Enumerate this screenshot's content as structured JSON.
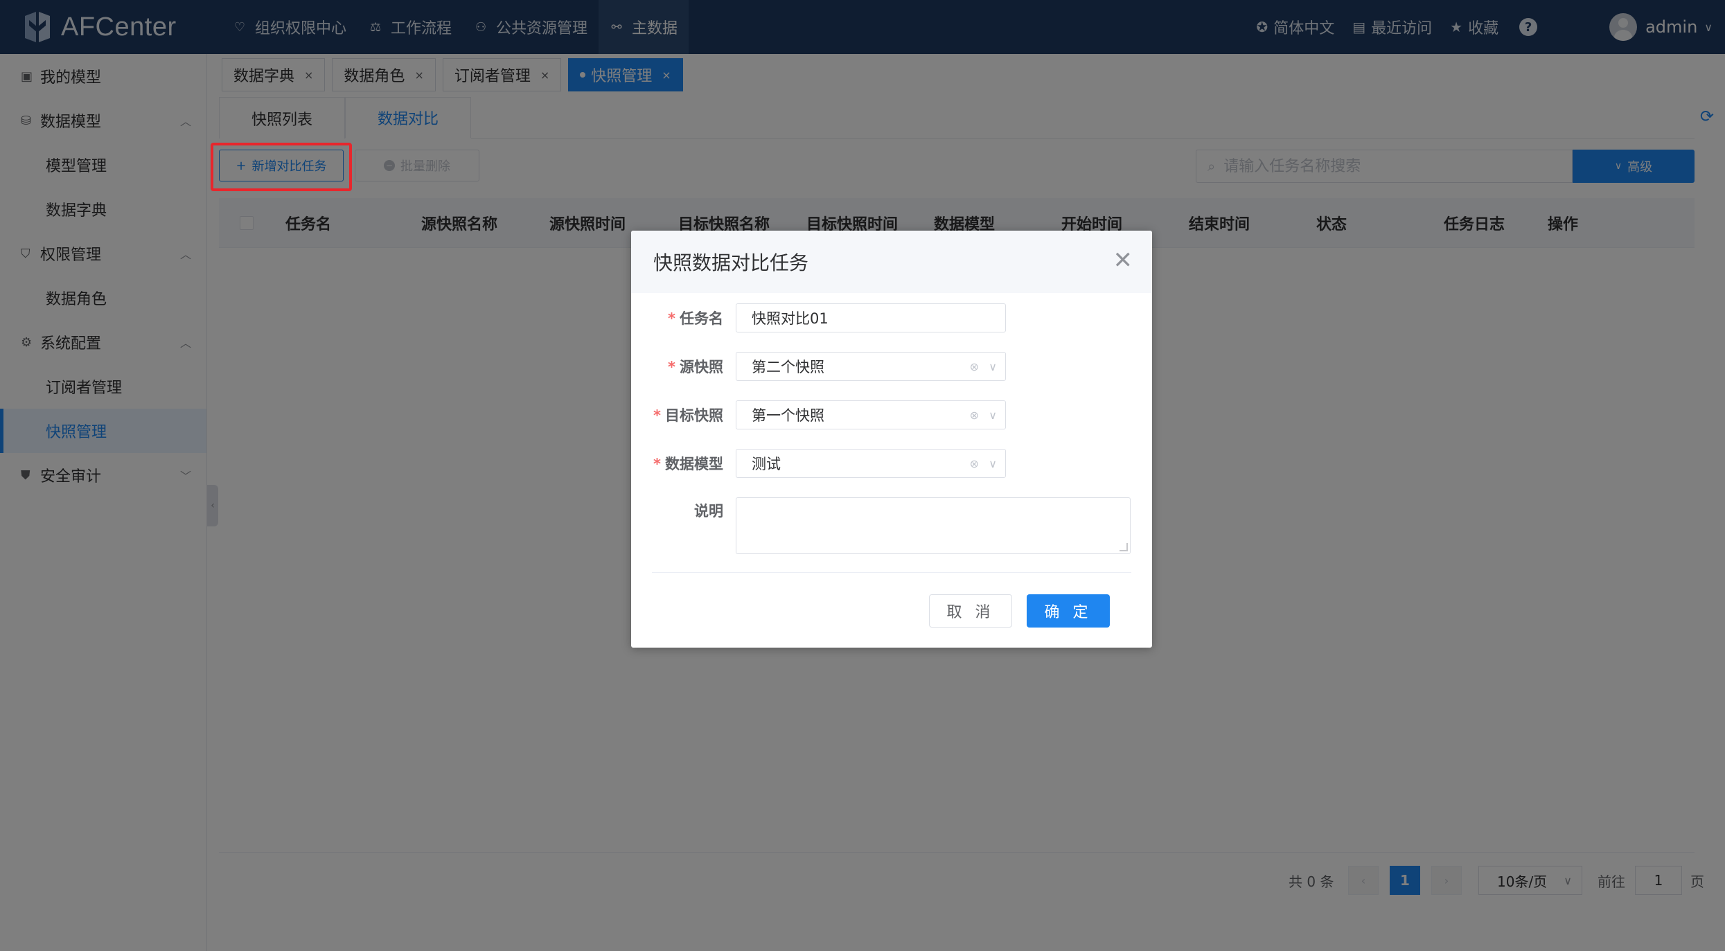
{
  "app": {
    "logo_text": "AFCenter",
    "nav": [
      {
        "label": "组织权限中心",
        "icon": "shield-icon"
      },
      {
        "label": "工作流程",
        "icon": "scale-icon"
      },
      {
        "label": "公共资源管理",
        "icon": "users-icon"
      },
      {
        "label": "主数据",
        "icon": "link-icon"
      }
    ],
    "language": "简体中文",
    "recent": "最近访问",
    "favorites": "收藏",
    "help": "?",
    "user": "admin"
  },
  "sidebar": {
    "items": [
      {
        "label": "我的模型"
      },
      {
        "label": "数据模型"
      },
      {
        "label": "模型管理"
      },
      {
        "label": "数据字典"
      },
      {
        "label": "权限管理"
      },
      {
        "label": "数据角色"
      },
      {
        "label": "系统配置"
      },
      {
        "label": "订阅者管理"
      },
      {
        "label": "快照管理"
      },
      {
        "label": "安全审计"
      }
    ]
  },
  "tags": [
    {
      "label": "数据字典"
    },
    {
      "label": "数据角色"
    },
    {
      "label": "订阅者管理"
    },
    {
      "label": "快照管理"
    }
  ],
  "subtabs": [
    {
      "label": "快照列表"
    },
    {
      "label": "数据对比"
    }
  ],
  "toolbar": {
    "new_task": "新增对比任务",
    "batch_delete": "批量删除",
    "search_placeholder": "请输入任务名称搜索",
    "advanced": "高级"
  },
  "table": {
    "columns": [
      "任务名",
      "源快照名称",
      "源快照时间",
      "目标快照名称",
      "目标快照时间",
      "数据模型",
      "开始时间",
      "结束时间",
      "状态",
      "任务日志",
      "操作"
    ]
  },
  "pagination": {
    "total": "共 0 条",
    "current_page": "1",
    "page_size": "10条/页",
    "goto": "前往",
    "goto_value": "1",
    "page_unit": "页"
  },
  "dialog": {
    "title": "快照数据对比任务",
    "fields": {
      "task_name_label": "任务名",
      "task_name_value": "快照对比01",
      "source_label": "源快照",
      "source_value": "第二个快照",
      "target_label": "目标快照",
      "target_value": "第一个快照",
      "model_label": "数据模型",
      "model_value": "测试",
      "desc_label": "说明"
    },
    "cancel": "取 消",
    "confirm": "确 定"
  }
}
